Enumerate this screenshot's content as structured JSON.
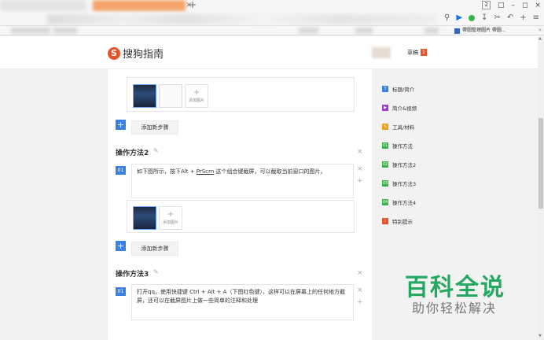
{
  "browser": {
    "tab_close": "×",
    "new_tab": "+",
    "tab_count": "2",
    "window_buttons": [
      "□",
      "–",
      "◻",
      "×"
    ],
    "toolbar_icons": [
      "search-icon",
      "play-icon",
      "green-dot-icon",
      "download-icon",
      "scissors-icon",
      "undo-icon",
      "plus-icon",
      "menu-icon"
    ],
    "bookmark_label": "帶圖整理圖片 帶圖...",
    "bookmark_more": "»"
  },
  "site": {
    "logo_mark": "S",
    "logo_text": "搜狗指南",
    "draft_label": "草稿",
    "draft_count": "1"
  },
  "editor": {
    "add_image_label": "添加图片",
    "add_step_label": "添加新步骤",
    "add_symbol": "+",
    "close_symbol": "×",
    "method2": {
      "title": "操作方法2",
      "step_num": "01",
      "text_before": "如下图所示，按下Alt + ",
      "text_underline": "PrScrn",
      "text_after": " 这个组合键截屏，可以截取当前窗口的图片。"
    },
    "method3": {
      "title": "操作方法3",
      "step_num": "01",
      "text": "打开qq，使用快捷键 Ctrl + Alt + A（下图红色键），这样可以在屏幕上的任何地方截屏，还可以在截屏图片上做一些简单的注释和处理"
    }
  },
  "sidenav": {
    "items": [
      {
        "label": "标题/简介",
        "color": "#3b82e0",
        "icon": "T"
      },
      {
        "label": "简介&视频",
        "color": "#a23bd1",
        "icon": "▶"
      },
      {
        "label": "工具/材料",
        "color": "#f0a020",
        "icon": "✎"
      },
      {
        "label": "操作方法",
        "color": "#3cb34a",
        "icon": "01"
      },
      {
        "label": "操作方法2",
        "color": "#3cb34a",
        "icon": "02"
      },
      {
        "label": "操作方法3",
        "color": "#3cb34a",
        "icon": "03"
      },
      {
        "label": "操作方法4",
        "color": "#3cb34a",
        "icon": "04"
      },
      {
        "label": "特别提示",
        "color": "#e8542a",
        "icon": "!"
      }
    ]
  },
  "watermark": {
    "title": "百科全说",
    "subtitle": "助你轻松解决"
  }
}
